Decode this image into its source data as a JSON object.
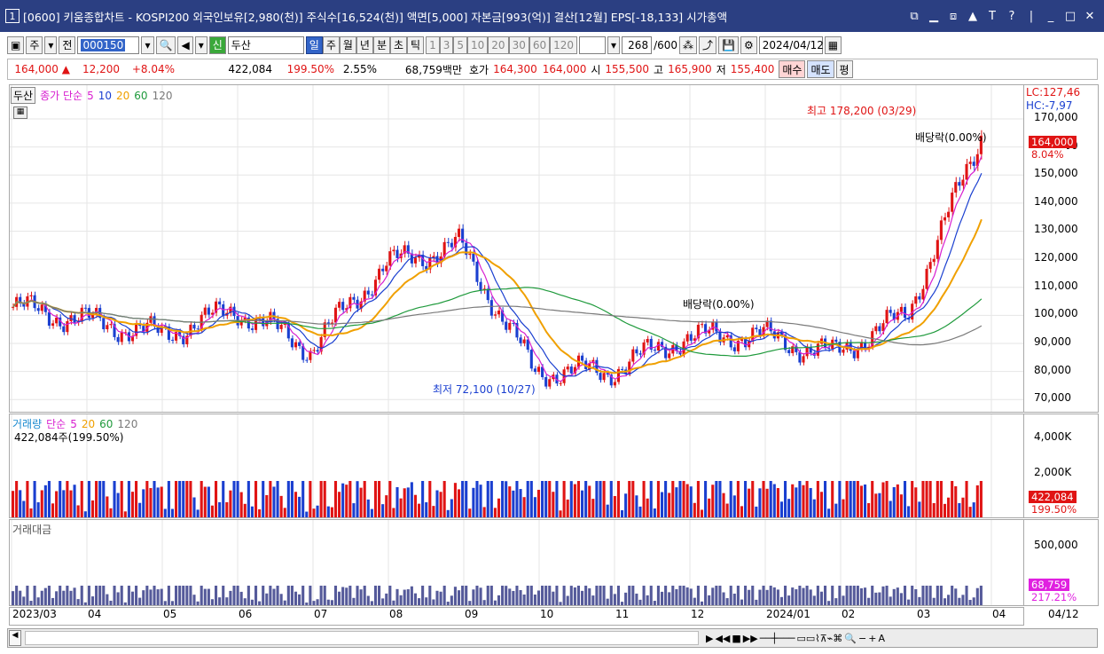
{
  "window": {
    "number": "1",
    "title": "[0600] 키움종합차트 - KOSPI200 외국인보유[2,980(천)] 주식수[16,524(천)] 액면[5,000] 자본금[993(억)] 결산[12월] EPS[-18,133] 시가총액"
  },
  "toolbar": {
    "main": "주",
    "prev": "전",
    "code": "000150",
    "market_badge": "신",
    "stock_name": "두산",
    "periods": [
      "일",
      "주",
      "월",
      "년",
      "분",
      "초",
      "틱"
    ],
    "active_period": "일",
    "intervals": [
      "1",
      "3",
      "5",
      "10",
      "20",
      "30",
      "60",
      "120"
    ],
    "count": "268",
    "count_total": "/600",
    "date": "2024/04/12"
  },
  "quote": {
    "price": "164,000",
    "arrow": "▲",
    "change": "12,200",
    "change_pct": "+8.04%",
    "volume": "422,084",
    "vol_ratio": "199.50%",
    "turnover": "2.55%",
    "amount": "68,759백만",
    "ask_label": "호가",
    "ask": "164,300",
    "bid": "164,000",
    "open_label": "시",
    "open": "155,500",
    "high_label": "고",
    "high": "165,900",
    "low_label": "저",
    "low": "155,400",
    "buy": "매수",
    "sell": "매도",
    "eval": "평"
  },
  "price_pane": {
    "legend_stock": "두산",
    "legend_ma": "종가 단순",
    "ma_periods": [
      "5",
      "10",
      "20",
      "60",
      "120"
    ],
    "lc": "LC:127,46",
    "hc": "HC:-7,97",
    "annot_high": "최고 178,200 (03/29)",
    "annot_low": "최저 72,100 (10/27)",
    "annot_div1": "배당락(0.00%)",
    "annot_div2": "배당락(0.00%)",
    "price_tag": "164,000",
    "pct_tag": "8.04%",
    "yticks": [
      "170,000",
      "160,000",
      "150,000",
      "140,000",
      "130,000",
      "120,000",
      "110,000",
      "100,000",
      "90,000",
      "80,000",
      "70,000"
    ]
  },
  "volume_pane": {
    "title": "거래량",
    "ma_label": "단순",
    "ma_periods": [
      "5",
      "20",
      "60",
      "120"
    ],
    "value_label": "422,084주(199.50%)",
    "yticks": [
      "4,000K",
      "2,000K"
    ],
    "tag": "422,084",
    "tag_pct": "199.50%"
  },
  "amount_pane": {
    "title": "거래대금",
    "yticks": [
      "500,000"
    ],
    "tag": "68,759",
    "tag_pct": "217.21%"
  },
  "xaxis": {
    "labels": [
      "2023/03",
      "04",
      "05",
      "06",
      "07",
      "08",
      "09",
      "10",
      "11",
      "12",
      "2024/01",
      "02",
      "03",
      "04"
    ],
    "right": "04/12"
  },
  "colors": {
    "up": "#e01414",
    "down": "#1a3fd0",
    "ma5": "#d81fd0",
    "ma10": "#1a3fd0",
    "ma20": "#f0a000",
    "ma60": "#1f9a3c",
    "ma120": "#7a7a7a"
  },
  "chart_data": {
    "type": "candlestick",
    "series": [
      {
        "name": "두산",
        "x_months": [
          "2023/03",
          "04",
          "05",
          "06",
          "07",
          "08",
          "09",
          "10",
          "11",
          "12",
          "2024/01",
          "02",
          "03",
          "04"
        ],
        "close": [
          103000,
          98000,
          93000,
          102000,
          88000,
          118000,
          125000,
          80000,
          80000,
          92000,
          93000,
          86000,
          100000,
          164000
        ]
      }
    ],
    "ylim": [
      65000,
      182000
    ],
    "marks": {
      "high": {
        "value": 178200,
        "date": "03/29"
      },
      "low": {
        "value": 72100,
        "date": "10/27"
      }
    }
  }
}
